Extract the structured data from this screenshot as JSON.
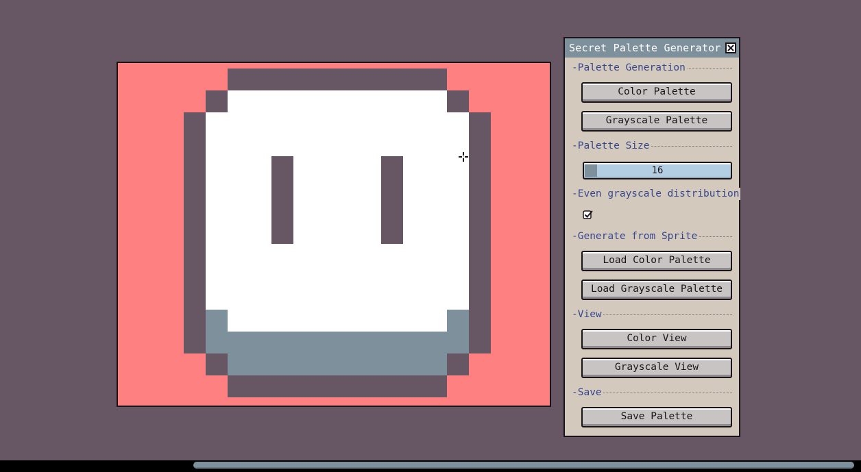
{
  "window": {
    "title": "Secret Palette Generator",
    "close_icon": "close-x-icon"
  },
  "sections": {
    "generation": "-Palette Generation",
    "size": "-Palette Size",
    "even": "-Even grayscale distribution",
    "from_sprite": "-Generate from Sprite",
    "view": "-View",
    "save": "-Save"
  },
  "buttons": {
    "color_palette": "Color Palette",
    "grayscale_palette": "Grayscale Palette",
    "load_color_palette": "Load Color Palette",
    "load_grayscale_palette": "Load Grayscale Palette",
    "color_view": "Color View",
    "grayscale_view": "Grayscale View",
    "save_palette": "Save Palette"
  },
  "palette_size": {
    "value": "16"
  },
  "even_distribution": {
    "checked": true
  },
  "colors": {
    "background": "#675663",
    "canvas": "#ff8080",
    "sprite_dark": "#675663",
    "sprite_light": "#ffffff",
    "sprite_shade": "#7d909c",
    "panel": "#d4c9bd",
    "title_bar": "#7d909c",
    "section_text": "#36478f"
  }
}
